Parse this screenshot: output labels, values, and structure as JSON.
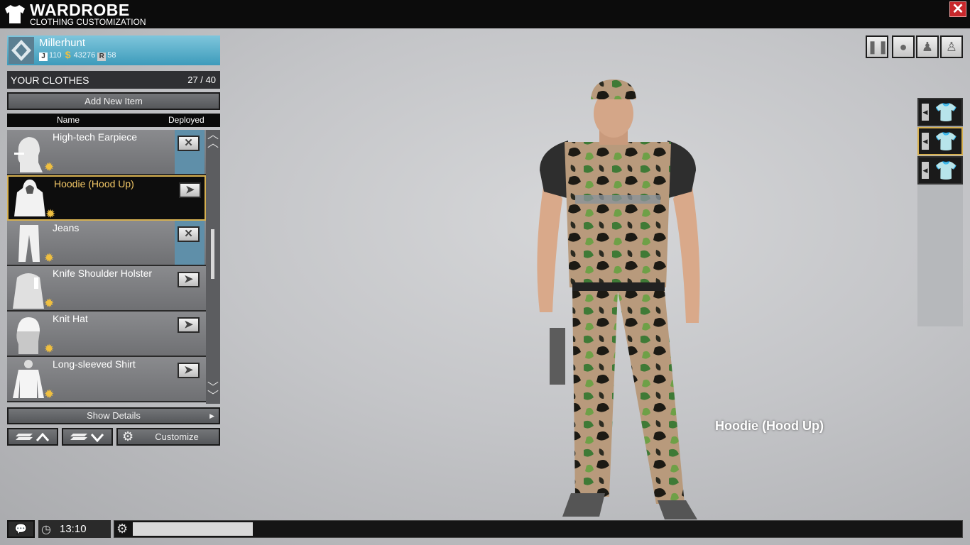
{
  "window": {
    "title": "WARDROBE",
    "subtitle": "CLOTHING CUSTOMIZATION",
    "close_label": "✕"
  },
  "player": {
    "name": "Millerhunt",
    "stat1": "110",
    "money": "43276",
    "stat3": "58"
  },
  "clothes": {
    "title": "YOUR CLOTHES",
    "count": "27 / 40"
  },
  "buttons": {
    "add_item": "Add New Item",
    "show_details": "Show Details",
    "customize": "Customize"
  },
  "columns": {
    "name": "Name",
    "deployed": "Deployed"
  },
  "items": [
    {
      "label": "High-tech Earpiece",
      "deployed": true
    },
    {
      "label": "Hoodie (Hood Up)",
      "deployed": false,
      "selected": true
    },
    {
      "label": "Jeans",
      "deployed": true
    },
    {
      "label": "Knife Shoulder Holster",
      "deployed": false
    },
    {
      "label": "Knit Hat",
      "deployed": false
    },
    {
      "label": "Long-sleeved Shirt",
      "deployed": false
    }
  ],
  "preview": {
    "item_label": "Hoodie (Hood Up)"
  },
  "clock": {
    "time": "13:10"
  },
  "loading": {
    "progress": 0.145
  },
  "colors": {
    "accent_gold": "#d6b050",
    "profile_blue": "#4aa3c2",
    "close_red": "#c8282c"
  }
}
